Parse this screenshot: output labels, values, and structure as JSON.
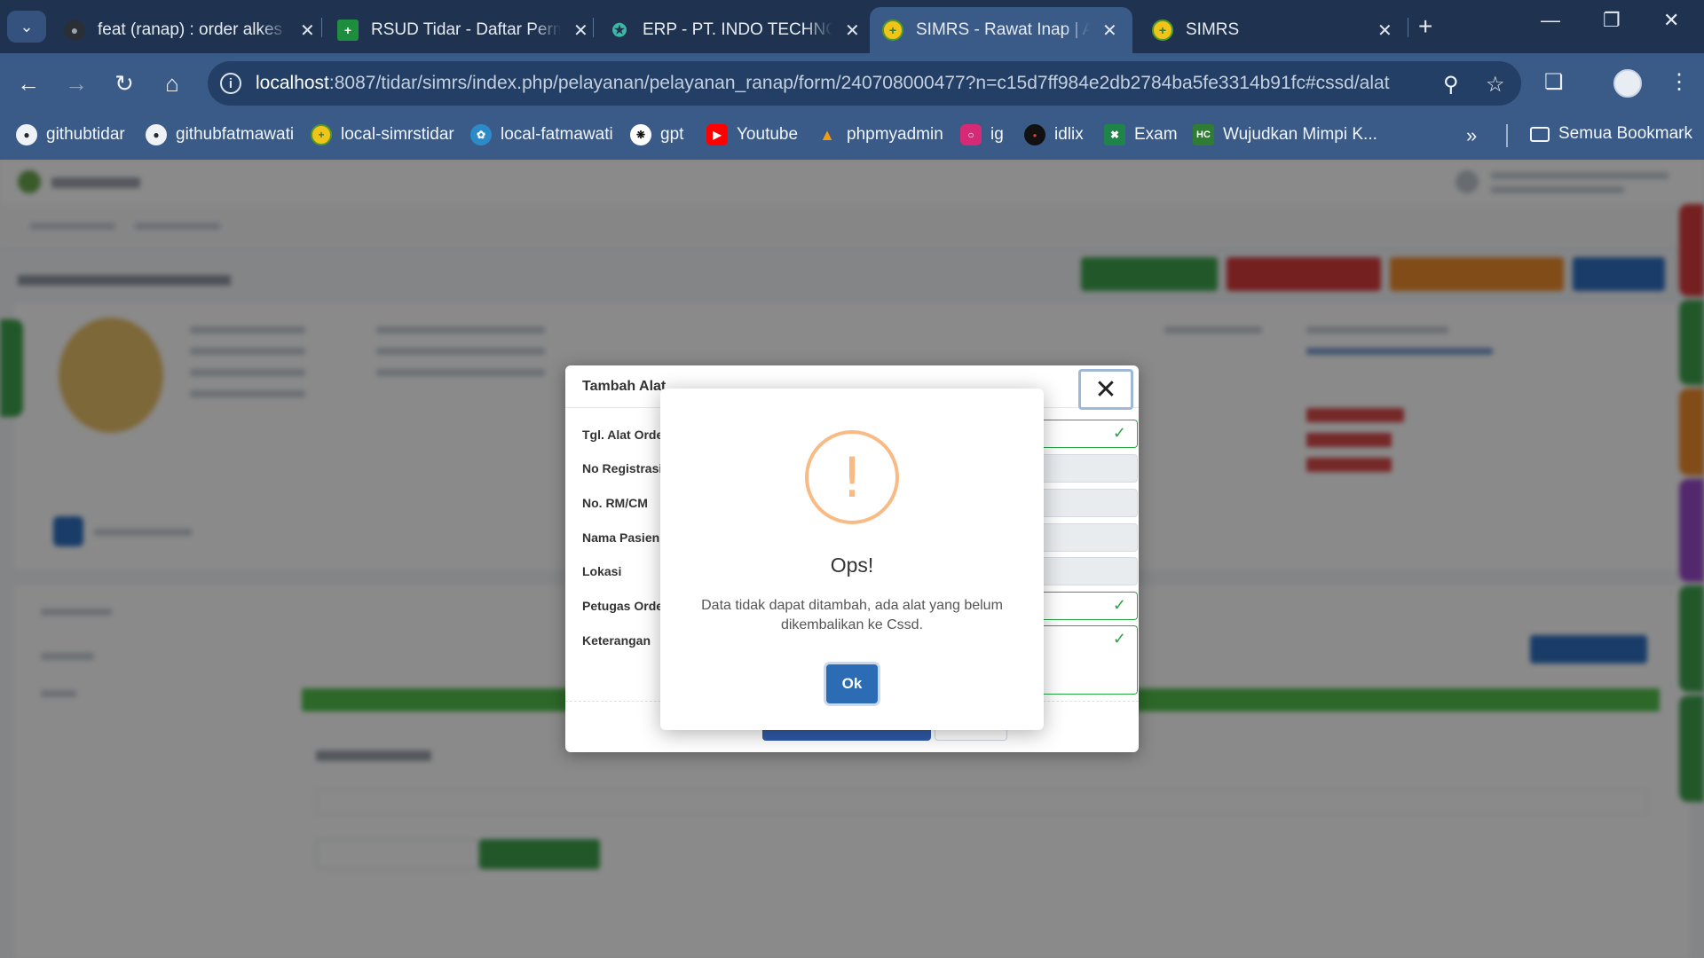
{
  "browser": {
    "tabs": [
      {
        "title": "feat (ranap) : order alkes",
        "favicon": "github-icon",
        "active": false
      },
      {
        "title": "RSUD Tidar - Daftar Perm",
        "favicon": "sheets-plus-icon",
        "active": false
      },
      {
        "title": "ERP - PT. INDO TECHNO",
        "favicon": "erp-tree-icon",
        "active": false
      },
      {
        "title": "SIMRS - Rawat Inap | ARI",
        "favicon": "simrs-logo-icon",
        "active": true
      },
      {
        "title": "SIMRS",
        "favicon": "simrs-logo-icon",
        "active": false
      }
    ],
    "url_host": "localhost",
    "url_rest": ":8087/tidar/simrs/index.php/pelayanan/pelayanan_ranap/form/240708000477?n=c15d7ff984e2db2784ba5fe3314b91fc#cssd/alat",
    "bookmarks": [
      {
        "label": "githubtidar",
        "icon": "github-icon",
        "color": "#24292f"
      },
      {
        "label": "githubfatmawati",
        "icon": "github-icon",
        "color": "#24292f"
      },
      {
        "label": "local-simrstidar",
        "icon": "simrs-logo-icon",
        "color": "#4f9a2b"
      },
      {
        "label": "local-fatmawati",
        "icon": "fatmawati-icon",
        "color": "#2d8ac9"
      },
      {
        "label": "gpt",
        "icon": "openai-icon",
        "color": "#ffffff"
      },
      {
        "label": "Youtube",
        "icon": "youtube-icon",
        "color": "#ff0000"
      },
      {
        "label": "phpmyadmin",
        "icon": "phpmyadmin-icon",
        "color": "#f39c12"
      },
      {
        "label": "ig",
        "icon": "instagram-icon",
        "color": "#d62976"
      },
      {
        "label": "idlix",
        "icon": "idlix-icon",
        "color": "#111111"
      },
      {
        "label": "Exam",
        "icon": "exam-icon",
        "color": "#1e8449"
      },
      {
        "label": "Wujudkan Mimpi K...",
        "icon": "hc-icon",
        "color": "#2e7d32",
        "icon_text": "HC"
      }
    ],
    "all_bookmarks_label": "Semua Bookmark"
  },
  "modal": {
    "title": "Tambah Alat",
    "fields": [
      {
        "label": "Tgl. Alat Order",
        "valid": true
      },
      {
        "label": "No Registrasi",
        "valid": false
      },
      {
        "label": "No. RM/CM",
        "valid": false
      },
      {
        "label": "Nama Pasien",
        "valid": false
      },
      {
        "label": "Lokasi",
        "valid": false
      },
      {
        "label": "Petugas Order",
        "valid": true
      },
      {
        "label": "Keterangan",
        "valid": true
      }
    ]
  },
  "alert": {
    "icon": "!",
    "title": "Ops!",
    "text": "Data tidak dapat ditambah, ada alat yang belum dikembalikan ke Cssd.",
    "ok_label": "Ok",
    "icon_color": "#f8bb86",
    "ok_color": "#2b6cb4"
  }
}
